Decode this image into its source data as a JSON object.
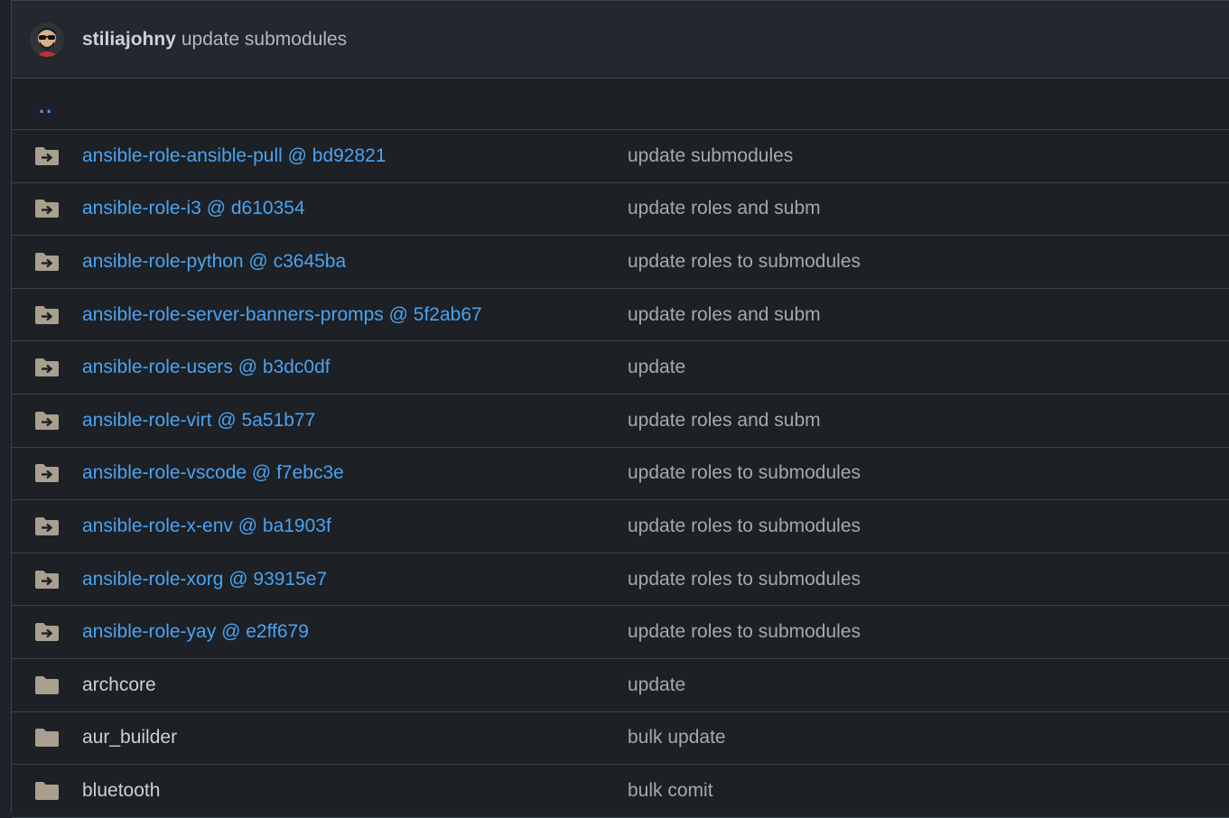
{
  "header": {
    "author": "stiliajohny",
    "message": "update submodules"
  },
  "parent_link": "..",
  "rows": [
    {
      "type": "submodule",
      "name": "ansible-role-ansible-pull @ bd92821",
      "commit": "update submodules"
    },
    {
      "type": "submodule",
      "name": "ansible-role-i3 @ d610354",
      "commit": "update roles and subm"
    },
    {
      "type": "submodule",
      "name": "ansible-role-python @ c3645ba",
      "commit": "update roles to submodules"
    },
    {
      "type": "submodule",
      "name": "ansible-role-server-banners-promps @ 5f2ab67",
      "commit": "update roles and subm"
    },
    {
      "type": "submodule",
      "name": "ansible-role-users @ b3dc0df",
      "commit": "update"
    },
    {
      "type": "submodule",
      "name": "ansible-role-virt @ 5a51b77",
      "commit": "update roles and subm"
    },
    {
      "type": "submodule",
      "name": "ansible-role-vscode @ f7ebc3e",
      "commit": "update roles to submodules"
    },
    {
      "type": "submodule",
      "name": "ansible-role-x-env @ ba1903f",
      "commit": "update roles to submodules"
    },
    {
      "type": "submodule",
      "name": "ansible-role-xorg @ 93915e7",
      "commit": "update roles to submodules"
    },
    {
      "type": "submodule",
      "name": "ansible-role-yay @ e2ff679",
      "commit": "update roles to submodules"
    },
    {
      "type": "folder",
      "name": "archcore",
      "commit": "update"
    },
    {
      "type": "folder",
      "name": "aur_builder",
      "commit": "bulk update"
    },
    {
      "type": "folder",
      "name": "bluetooth",
      "commit": "bulk comit"
    }
  ],
  "colors": {
    "link": "#4aa3f0",
    "folder_icon": "#a89f8f",
    "border": "#3d434b"
  }
}
